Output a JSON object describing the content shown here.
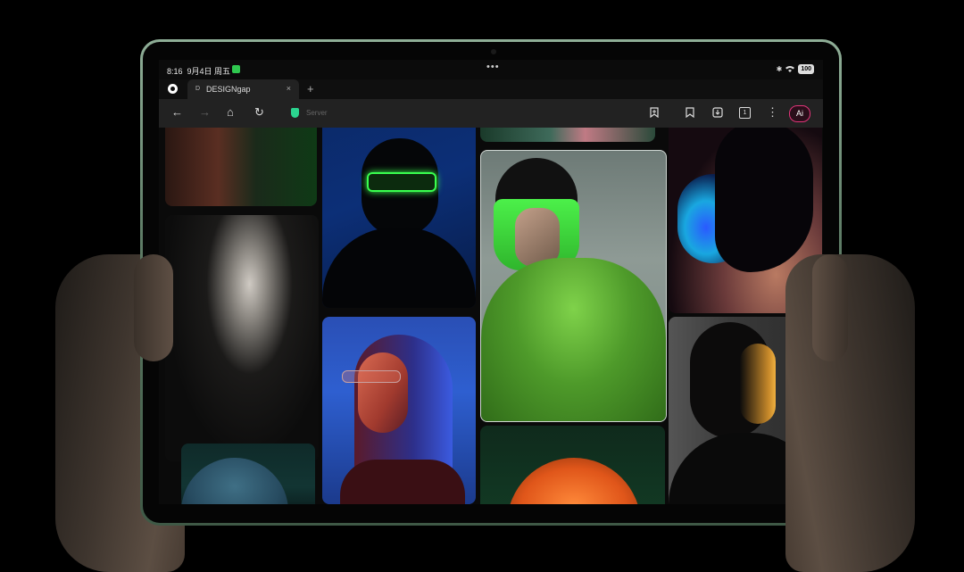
{
  "status_bar": {
    "time": "8:16",
    "date": "9月4日 周五",
    "handle_dots": "•••",
    "icons": [
      "bluetooth-icon",
      "wifi-icon"
    ],
    "battery": "100"
  },
  "tabs": [
    {
      "favicon": "D",
      "title": "DESIGNgap",
      "close": "×"
    }
  ],
  "new_tab": "+",
  "toolbar": {
    "back": "←",
    "forward": "→",
    "home": "⌂",
    "reload": "↻",
    "url": "Server",
    "tab_count": "1",
    "menu": "⋮",
    "ai_label": "Ai"
  },
  "colors": {
    "accent_shield": "#2bd48f",
    "ai_badge": "#e2357a",
    "frame": "#6f8e77"
  }
}
